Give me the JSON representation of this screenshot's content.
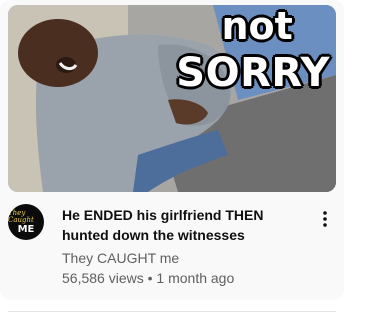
{
  "video": {
    "thumbnail_caption_line1": "not",
    "thumbnail_caption_line2": "SORRY",
    "title": "He ENDED his girlfriend THEN hunted down the witnesses",
    "channel": "They CAUGHT me",
    "views": "56,586 views",
    "separator": "•",
    "age": "1 month ago"
  },
  "channel_avatar": {
    "logo_line1": "They Caught",
    "logo_line2": "ME"
  },
  "icons": {
    "menu": "more-vert-icon"
  }
}
